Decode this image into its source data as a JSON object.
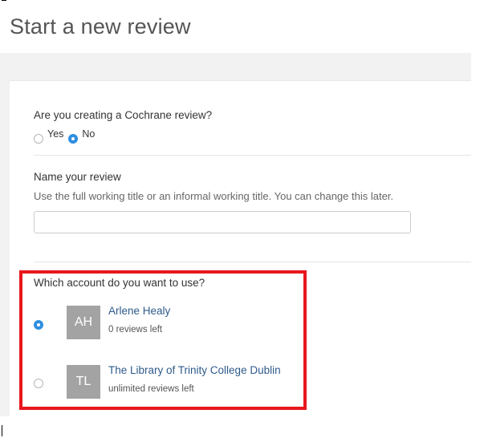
{
  "page": {
    "title": "Start a new review"
  },
  "cochrane": {
    "question": "Are you creating a Cochrane review?",
    "options": [
      {
        "label": "Yes",
        "selected": false
      },
      {
        "label": "No",
        "selected": true
      }
    ]
  },
  "name_review": {
    "label": "Name your review",
    "helper": "Use the full working title or an informal working title. You can change this later.",
    "value": "",
    "placeholder": ""
  },
  "account": {
    "question": "Which account do you want to use?",
    "accounts": [
      {
        "initials": "AH",
        "name": "Arlene Healy",
        "meta": "0 reviews left",
        "selected": true
      },
      {
        "initials": "TL",
        "name": "The Library of Trinity College Dublin",
        "meta": "unlimited reviews left",
        "selected": false
      }
    ]
  },
  "colors": {
    "accent": "#2f8fe0",
    "highlight": "#e8171c",
    "link": "#2e5a8a",
    "avatar": "#a3a3a3"
  }
}
